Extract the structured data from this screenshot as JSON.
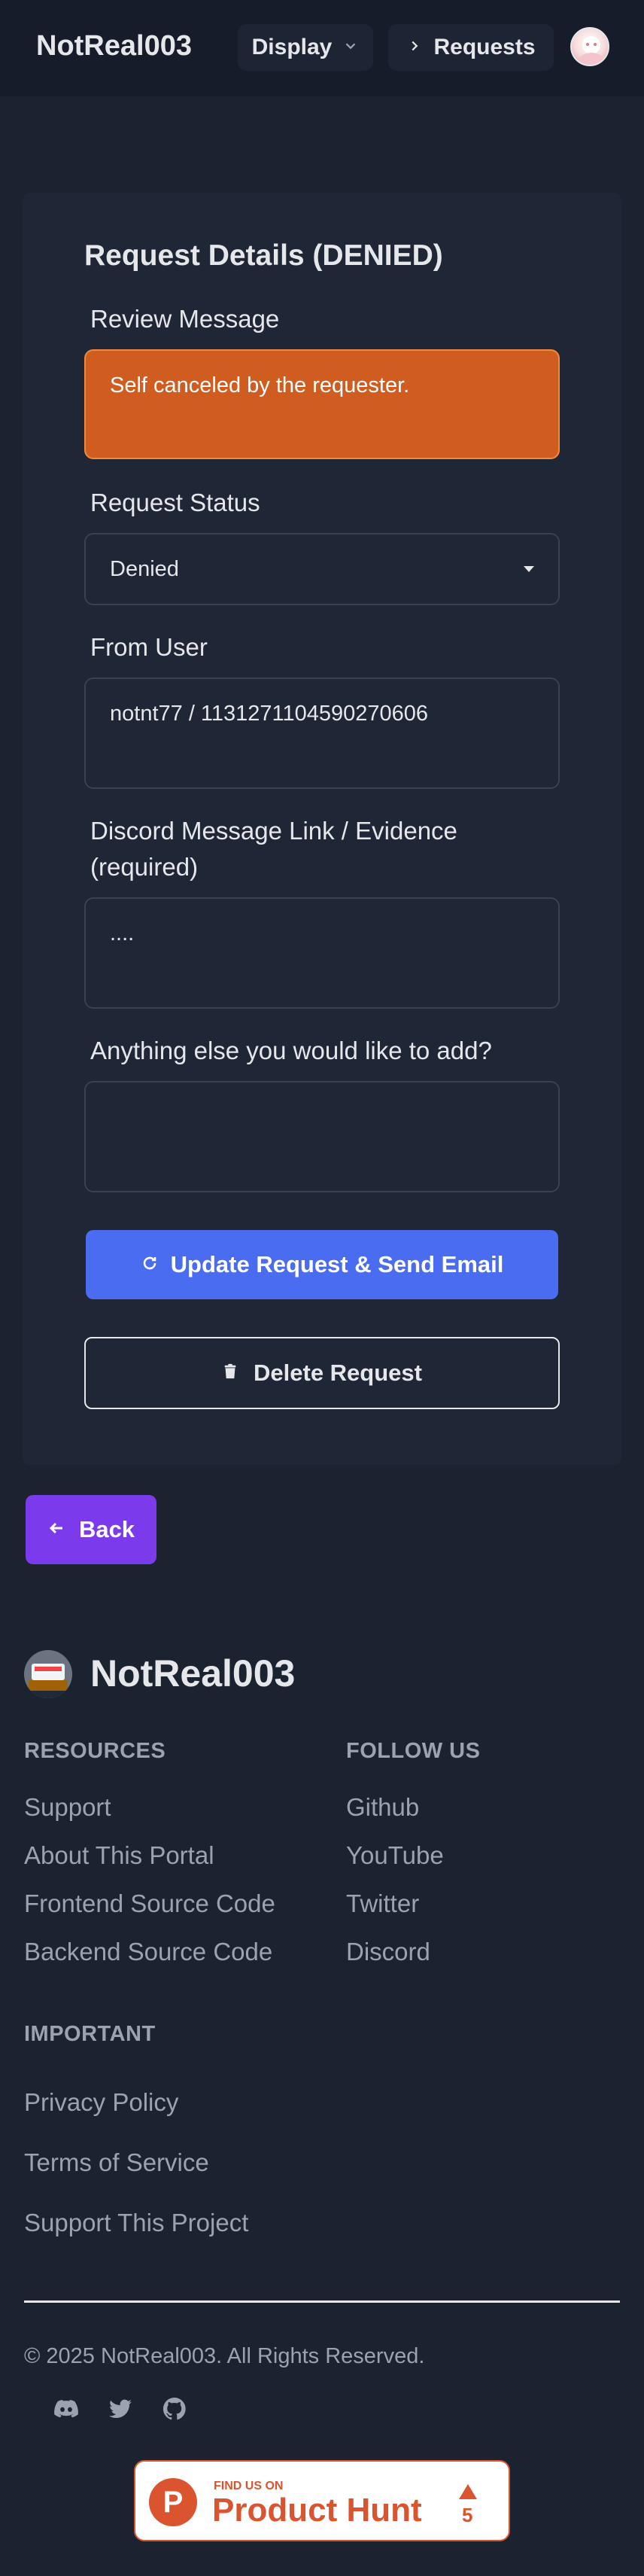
{
  "navbar": {
    "brand": "NotReal003",
    "display_label": "Display",
    "requests_label": "Requests"
  },
  "request": {
    "title": "Request Details (DENIED)",
    "review_message_label": "Review Message",
    "review_message": "Self canceled by the requester.",
    "status_label": "Request Status",
    "status_value": "Denied",
    "from_user_label": "From User",
    "from_user_value": "notnt77 / 1131271104590270606",
    "evidence_label_line1": "Discord Message Link / Evidence",
    "evidence_label_line2": "(required)",
    "evidence_value": "....",
    "additional_label": "Anything else you would like to add?",
    "additional_value": "",
    "update_button": "Update Request & Send Email",
    "delete_button": "Delete Request",
    "back_button": "Back"
  },
  "footer": {
    "brand": "NotReal003",
    "resources_heading": "RESOURCES",
    "resources": [
      "Support",
      "About This Portal",
      "Frontend Source Code",
      "Backend Source Code"
    ],
    "follow_heading": "FOLLOW US",
    "follow": [
      "Github",
      "YouTube",
      "Twitter",
      "Discord"
    ],
    "important_heading": "IMPORTANT",
    "important": [
      "Privacy Policy",
      "Terms of Service",
      "Support This Project"
    ],
    "copyright": "© 2025 NotReal003. All Rights Reserved.",
    "social_icons": [
      "discord-icon",
      "twitter-icon",
      "github-icon"
    ]
  },
  "product_hunt": {
    "find_us": "FIND US ON",
    "name": "Product Hunt",
    "letter": "P",
    "count": "5"
  },
  "colors": {
    "review_bg": "#d05c20",
    "update_button": "#4a6cf0",
    "back_button": "#7c3aed",
    "product_hunt": "#da552f"
  }
}
